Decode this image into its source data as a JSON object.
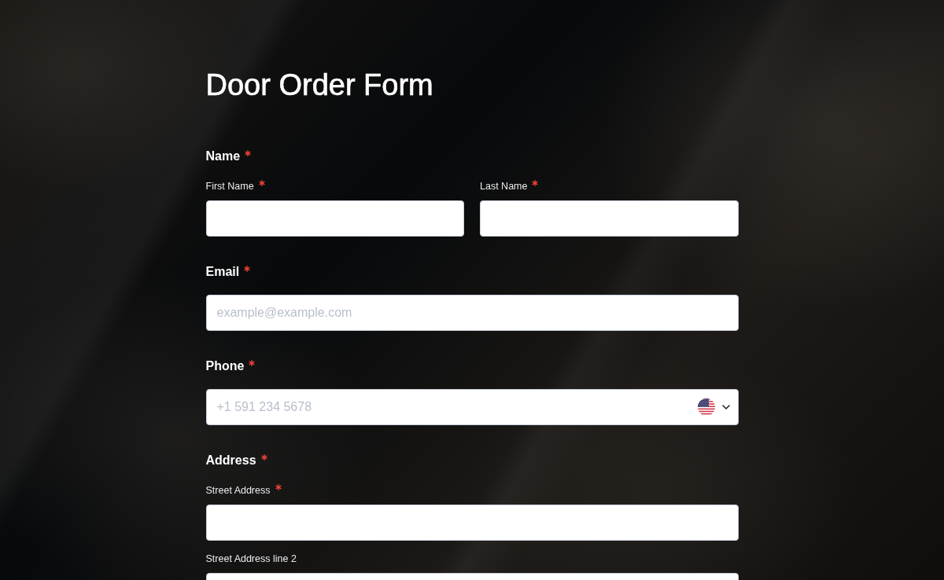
{
  "title": "Door Order Form",
  "sections": [
    {
      "label": "Name",
      "required": true,
      "kind": "columns",
      "fields": [
        {
          "label": "First Name",
          "required": true
        },
        {
          "label": "Last Name",
          "required": true
        }
      ]
    },
    {
      "label": "Email",
      "required": true,
      "kind": "email",
      "fields": [
        {
          "placeholder": "example@example.com"
        }
      ]
    },
    {
      "label": "Phone",
      "required": true,
      "kind": "phone",
      "fields": [
        {
          "placeholder": "+1 591 234 5678"
        }
      ]
    },
    {
      "label": "Address",
      "required": true,
      "kind": "stack",
      "fields": [
        {
          "label": "Street Address",
          "required": true
        },
        {
          "label": "Street Address line 2",
          "required": false
        }
      ]
    }
  ]
}
